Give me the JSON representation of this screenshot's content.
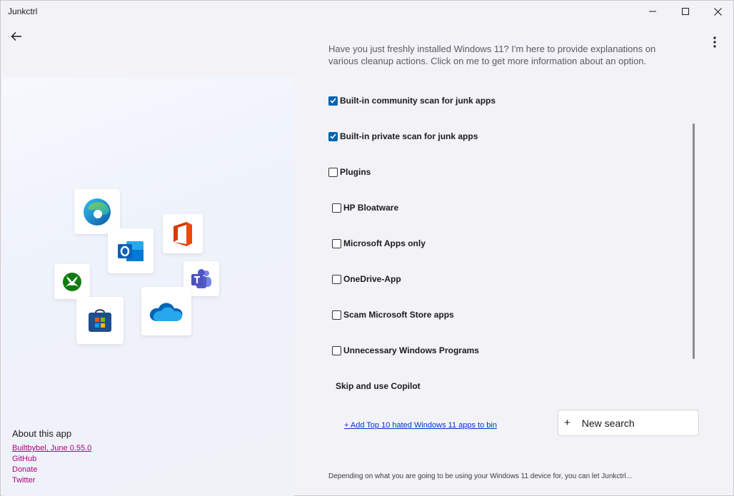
{
  "window": {
    "title": "Junkctrl"
  },
  "intro_text": "Have you just freshly installed Windows 11? I'm here to provide explanations on various cleanup actions. Click on me to get more information about an option.",
  "options": [
    {
      "label": "Built-in community scan for junk apps",
      "checked": true
    },
    {
      "label": "Built-in private scan for junk apps",
      "checked": true
    },
    {
      "label": "Plugins",
      "checked": false
    },
    {
      "label": "HP Bloatware",
      "checked": false
    },
    {
      "label": "Microsoft Apps only",
      "checked": false
    },
    {
      "label": "OneDrive-App",
      "checked": false
    },
    {
      "label": "Scam Microsoft Store apps",
      "checked": false
    },
    {
      "label": "Unnecessary Windows Programs",
      "checked": false
    },
    {
      "label": "Skip and use Copilot"
    }
  ],
  "add_link": "+ Add Top 10 hated Windows 11 apps to bin",
  "search_button": {
    "icon": "+",
    "label": "New search"
  },
  "footer": "Depending on what you are going to be using your Windows 11 device for, you can let Junkctrl...",
  "about": {
    "title": "About this app",
    "version": "Builtbybel, June 0.55.0",
    "links": [
      "GitHub",
      "Donate",
      "Twitter"
    ]
  },
  "icons": [
    "back-arrow-icon",
    "more-vertical-icon",
    "edge-icon",
    "outlook-icon",
    "office-icon",
    "xbox-icon",
    "teams-icon",
    "store-icon",
    "onedrive-icon"
  ],
  "colors": {
    "accent": "#0063b1",
    "about_link": "#b3007b",
    "add_link": "#0033cc"
  }
}
